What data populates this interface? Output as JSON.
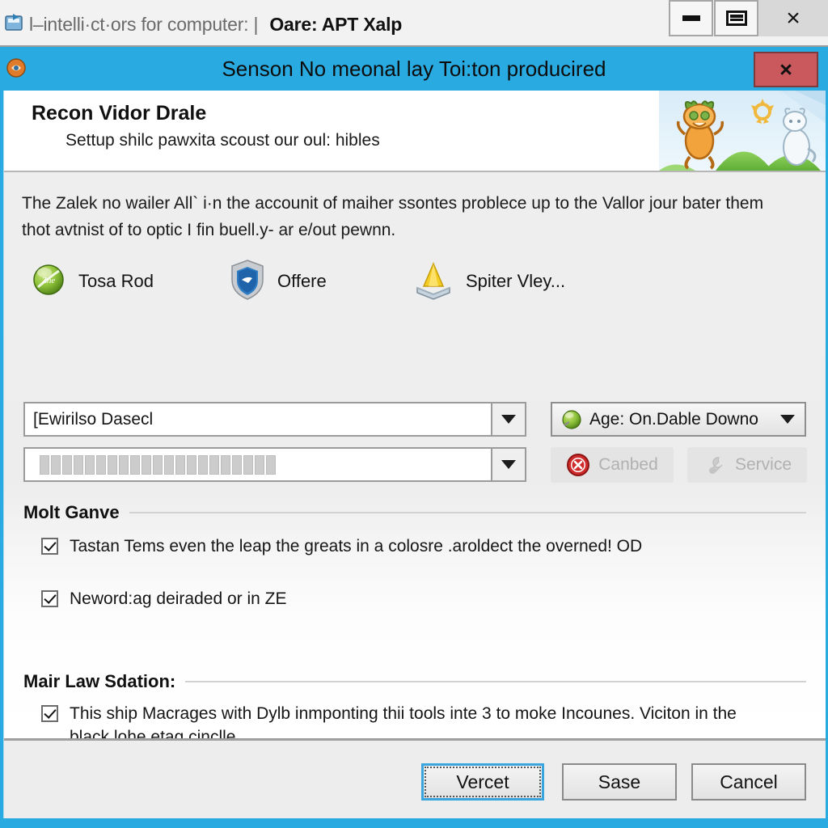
{
  "parent_window": {
    "icon": "app-window-icon",
    "title": "l–intelli·ct·ors for computer: |",
    "title_accent": "Oare: APT Xalp",
    "buttons": {
      "minimize": "minimize-button",
      "maximize": "maximize-button",
      "close": "×"
    }
  },
  "dialog": {
    "icon": "dialog-app-icon",
    "title": "Senson No meonal lay Toi:ton producired",
    "close_label": "×",
    "banner": {
      "title": "Recon Vidor Drale",
      "subtitle": "Settup shilc pawxita scoust our oul: hibles",
      "art": "cat-sun-hills-illustration"
    },
    "intro_text": "The Zalek no wailer All` i·n the accounit of maiher ssontes problece up to the Vallor jour bater them thot avtnist of to optic I fin buell.y- ar e/out pewnn.",
    "icon_row": [
      {
        "icon": "green-orb-icon",
        "label": "Tosa Rod"
      },
      {
        "icon": "blue-shield-icon",
        "label": "Offere"
      },
      {
        "icon": "yellow-cone-tray-icon",
        "label": "Spiter Vley..."
      }
    ],
    "combos": [
      {
        "value": "[Ewirilso Dasecl",
        "masked": false
      },
      {
        "value": "",
        "masked": true,
        "mask_tile_count": 21
      }
    ],
    "age_button": {
      "icon": "green-orb-icon",
      "label": "Age: On.Dable Downo",
      "arrow": "chevron-down-icon"
    },
    "disabled_buttons": [
      {
        "icon": "red-cancel-icon",
        "label": "Canbed"
      },
      {
        "icon": "gray-wrench-icon",
        "label": "Service"
      }
    ],
    "groups": [
      {
        "title": "Molt Ganve",
        "checkboxes": [
          {
            "checked": true,
            "label": "Tastan Tems even the leap the greats in a colosre .aroldect the overned! OD"
          },
          {
            "checked": true,
            "label": "Neword:ag deiraded or in ZE"
          }
        ]
      },
      {
        "title": "Mair Law Sdation:",
        "checkboxes": [
          {
            "checked": true,
            "label": "This ship Macrages with Dylb inmponting thii tools inte 3 to moke Incounes. Viciton in the black lohe etag cinclle."
          }
        ]
      }
    ],
    "footer_buttons": [
      {
        "label": "Vercet",
        "default": true
      },
      {
        "label": "Sase",
        "default": false
      },
      {
        "label": "Cancel",
        "default": false
      }
    ]
  },
  "colors": {
    "dialog_chrome": "#29abe2",
    "close_red": "#c9595c",
    "focus_blue": "#3aa4dd",
    "content_gray": "#ededed"
  }
}
